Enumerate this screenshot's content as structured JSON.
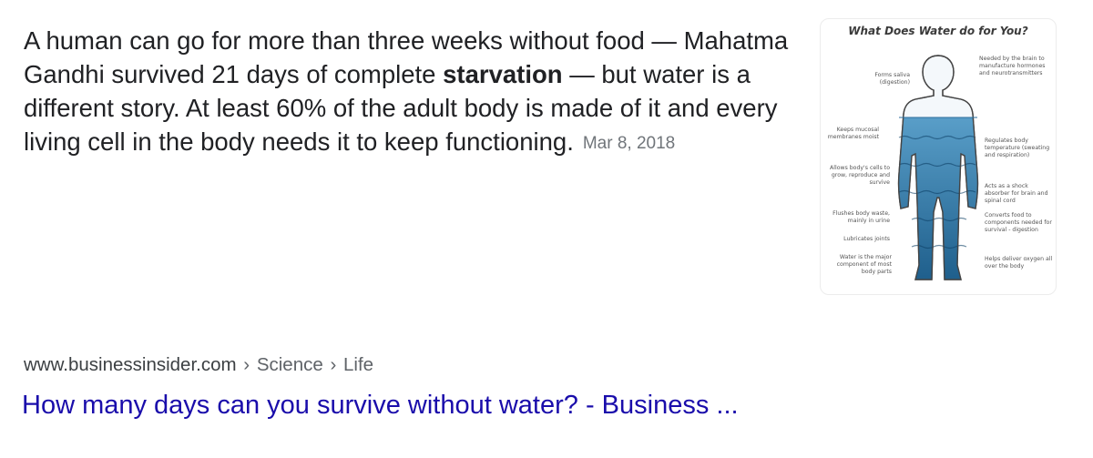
{
  "snippet": {
    "text_before": "A human can go for more than three weeks without food — Mahatma Gandhi survived 21 days of complete ",
    "bold": "starvation",
    "text_after": " — but water is a different story. At least 60% of the adult body is made of it and every living cell in the body needs it to keep functioning.",
    "date": "Mar 8, 2018"
  },
  "thumbnail": {
    "title": "What Does Water do for You?",
    "captions_left": [
      "Forms saliva (digestion)",
      "Keeps mucosal membranes moist",
      "Allows body's cells to grow, reproduce and survive",
      "Flushes body waste, mainly in urine",
      "Lubricates joints",
      "Water is the major component of most body parts"
    ],
    "captions_right": [
      "Needed by the brain to manufacture hormones and neurotransmitters",
      "Regulates body temperature (sweating and respiration)",
      "Acts as a shock absorber for brain and spinal cord",
      "Converts food to components needed for survival - digestion",
      "Helps deliver oxygen all over the body"
    ],
    "colors": {
      "water": "#4a9fd0",
      "water_dark": "#1f5f8c",
      "outline": "#555555"
    }
  },
  "result": {
    "cite_domain": "www.businessinsider.com",
    "breadcrumbs": [
      "Science",
      "Life"
    ],
    "breadcrumb_separator": "›",
    "title": "How many days can you survive without water? - Business ..."
  },
  "colors": {
    "link": "#1a0dab",
    "text": "#202124",
    "meta": "#70757a"
  }
}
